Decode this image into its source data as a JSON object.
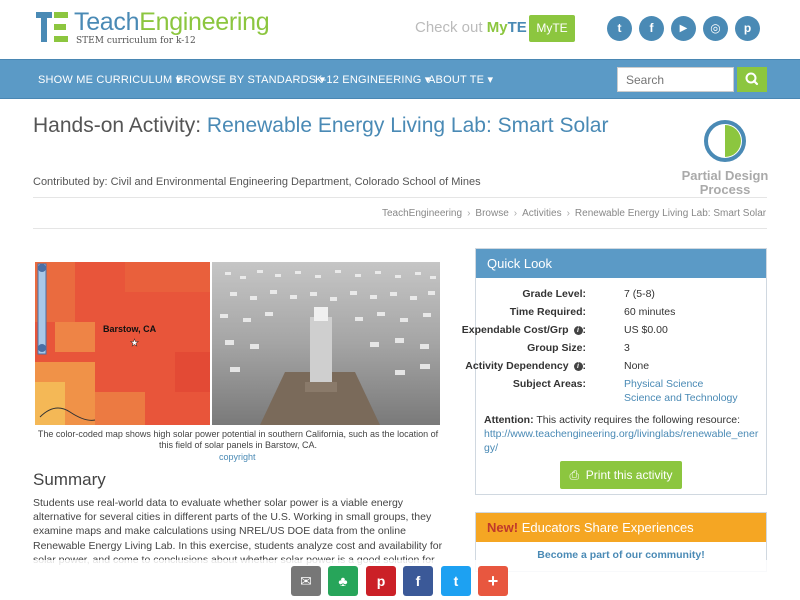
{
  "header": {
    "brand_part1": "Teach",
    "brand_part2": "Engineering",
    "tagline": "STEM curriculum for k-12",
    "checkout_text": "Check out",
    "myte_part1": "My",
    "myte_part2": "TE",
    "myte_button": "MyTE",
    "social": [
      {
        "icon": "twitter-icon",
        "glyph": "t"
      },
      {
        "icon": "facebook-icon",
        "glyph": "f"
      },
      {
        "icon": "youtube-icon",
        "glyph": "▶"
      },
      {
        "icon": "instagram-icon",
        "glyph": "◎"
      },
      {
        "icon": "pinterest-icon",
        "glyph": "p"
      }
    ]
  },
  "nav": {
    "items": [
      "SHOW ME CURRICULUM ▾",
      "BROWSE BY STANDARDS ▾",
      "K-12 ENGINEERING ▾",
      "ABOUT TE ▾"
    ],
    "search_placeholder": "Search"
  },
  "page": {
    "title_prefix": "Hands-on Activity:",
    "title_main": "Renewable Energy Living Lab: Smart Solar",
    "contributed_by": "Contributed by: Civil and Environmental Engineering Department, Colorado School of Mines",
    "design_process": "Partial Design Process",
    "breadcrumbs": [
      "TeachEngineering",
      "Browse",
      "Activities",
      "Renewable Energy Living Lab: Smart Solar"
    ]
  },
  "image": {
    "map_label": "Barstow, CA",
    "caption": "The color-coded map shows high solar power potential in southern California, such as the location of this field of solar panels in Barstow, CA.",
    "copyright": "copyright"
  },
  "summary": {
    "heading": "Summary",
    "text": "Students use real-world data to evaluate whether solar power is a viable energy alternative for several cities in different parts of the U.S. Working in small groups, they examine maps and make calculations using NREL/US DOE data from the online Renewable Energy Living Lab. In this exercise, students analyze cost and availability for solar power, and come to conclusions about whether solar power is a good solution for"
  },
  "quick_look": {
    "heading": "Quick Look",
    "rows": [
      {
        "label": "Grade Level:",
        "value": "7 (5-8)"
      },
      {
        "label": "Time Required:",
        "value": "60 minutes"
      },
      {
        "label": "Expendable Cost/Grp",
        "value": "US $0.00"
      },
      {
        "label": "Group Size:",
        "value": "3"
      },
      {
        "label": "Activity Dependency",
        "value": "None"
      },
      {
        "label": "Subject Areas:",
        "value": "Physical Science"
      }
    ],
    "subject_area_2": "Science and Technology",
    "attention_label": "Attention:",
    "attention_text": "This activity requires the following resource:",
    "resource_url": "http://www.teachengineering.org/livinglabs/renewable_energy/",
    "print_button": "Print this activity"
  },
  "educators": {
    "new_label": "New!",
    "heading": "Educators Share Experiences",
    "sub": "Become a part of our community!"
  },
  "share_bar": [
    {
      "icon": "email-icon",
      "glyph": "✉",
      "color": "#777777"
    },
    {
      "icon": "google-classroom-icon",
      "glyph": "♣",
      "color": "#27a55a"
    },
    {
      "icon": "pinterest-icon",
      "glyph": "p",
      "color": "#cb2027"
    },
    {
      "icon": "facebook-icon",
      "glyph": "f",
      "color": "#3b5998"
    },
    {
      "icon": "twitter-icon",
      "glyph": "t",
      "color": "#1da1f2"
    },
    {
      "icon": "more-icon",
      "glyph": "+",
      "color": "#e8573f"
    }
  ],
  "colors": {
    "brand_blue": "#4a8ab5",
    "brand_green": "#8cc63f",
    "nav_blue": "#5b9ac6",
    "orange": "#f5a623"
  }
}
